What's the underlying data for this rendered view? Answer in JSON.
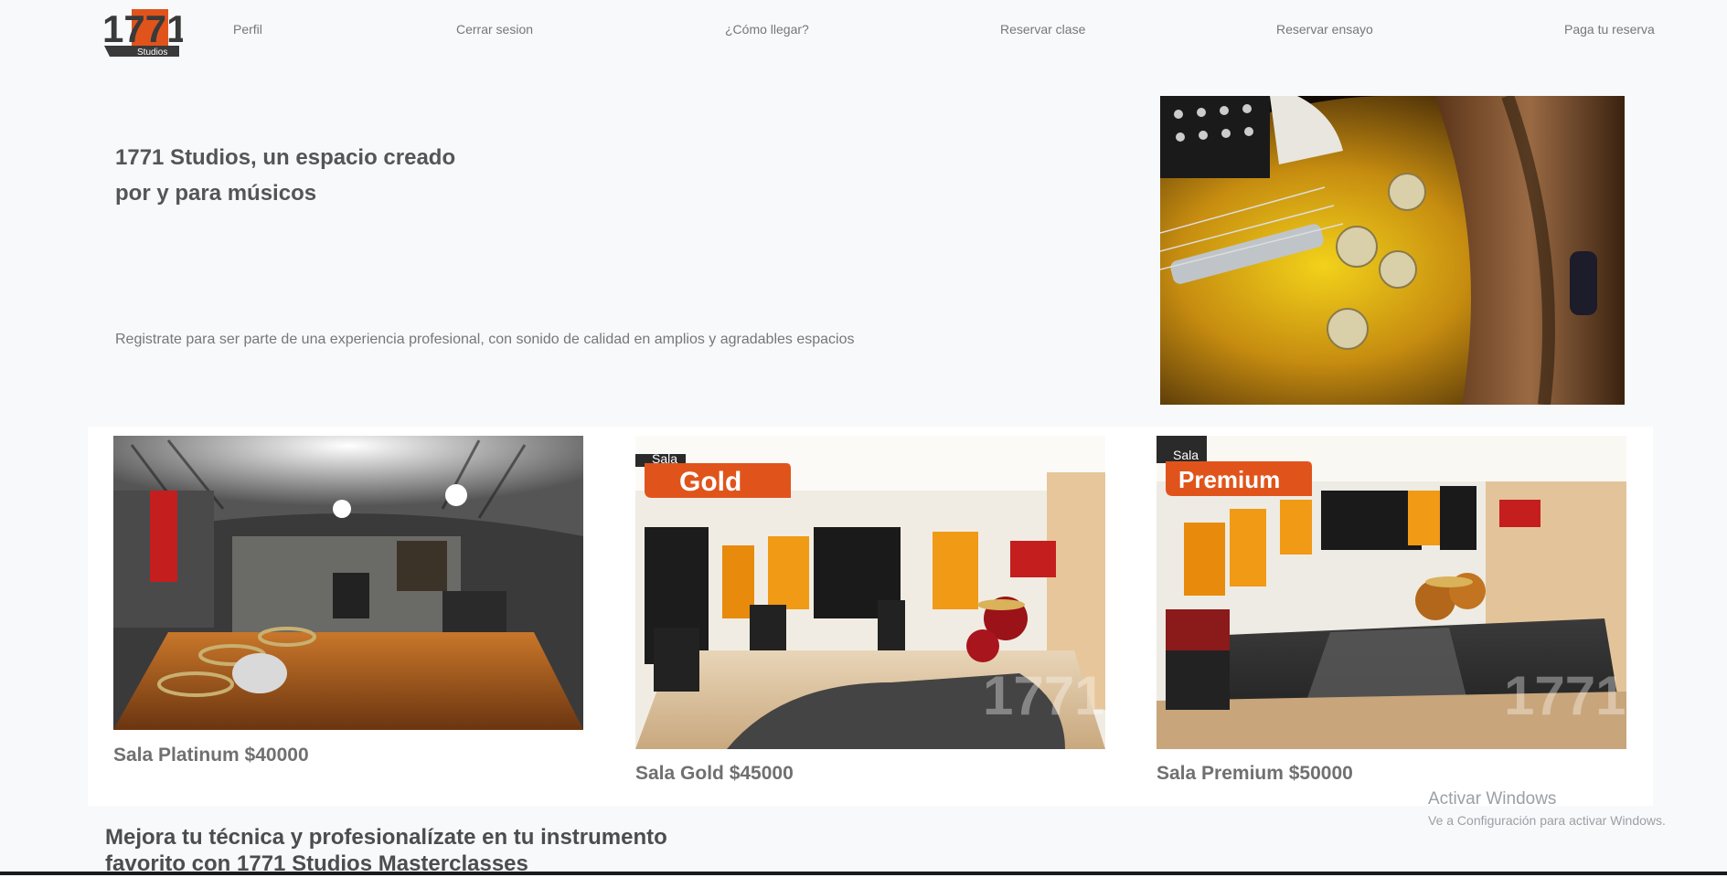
{
  "brand": {
    "logo_number": "1771",
    "logo_sub": "Studios"
  },
  "nav": {
    "items": [
      {
        "label": "Perfil"
      },
      {
        "label": "Cerrar sesion"
      },
      {
        "label": "¿Cómo llegar?"
      },
      {
        "label": "Reservar clase"
      },
      {
        "label": "Reservar ensayo"
      },
      {
        "label": "Paga tu reserva"
      }
    ]
  },
  "hero": {
    "title": "1771 Studios, un espacio creado por y para músicos",
    "subtitle": "Registrate para ser parte de una experiencia profesional, con sonido de calidad en amplios y agradables espacios"
  },
  "rooms": [
    {
      "name": "Sala Platinum $40000"
    },
    {
      "name": "Sala Gold $45000",
      "badge_small": "Sala",
      "badge_big": "Gold"
    },
    {
      "name": "Sala Premium $50000",
      "badge_small": "Sala",
      "badge_big": "Premium"
    }
  ],
  "masterclass": {
    "title": "Mejora tu técnica y profesionalízate en tu instrumento favorito con 1771 Studios Masterclasses"
  },
  "watermark": {
    "line1": "Activar Windows",
    "line2": "Ve a Configuración para activar Windows."
  },
  "colors": {
    "accent": "#e0541c",
    "text": "#555555",
    "nav": "#777777"
  }
}
